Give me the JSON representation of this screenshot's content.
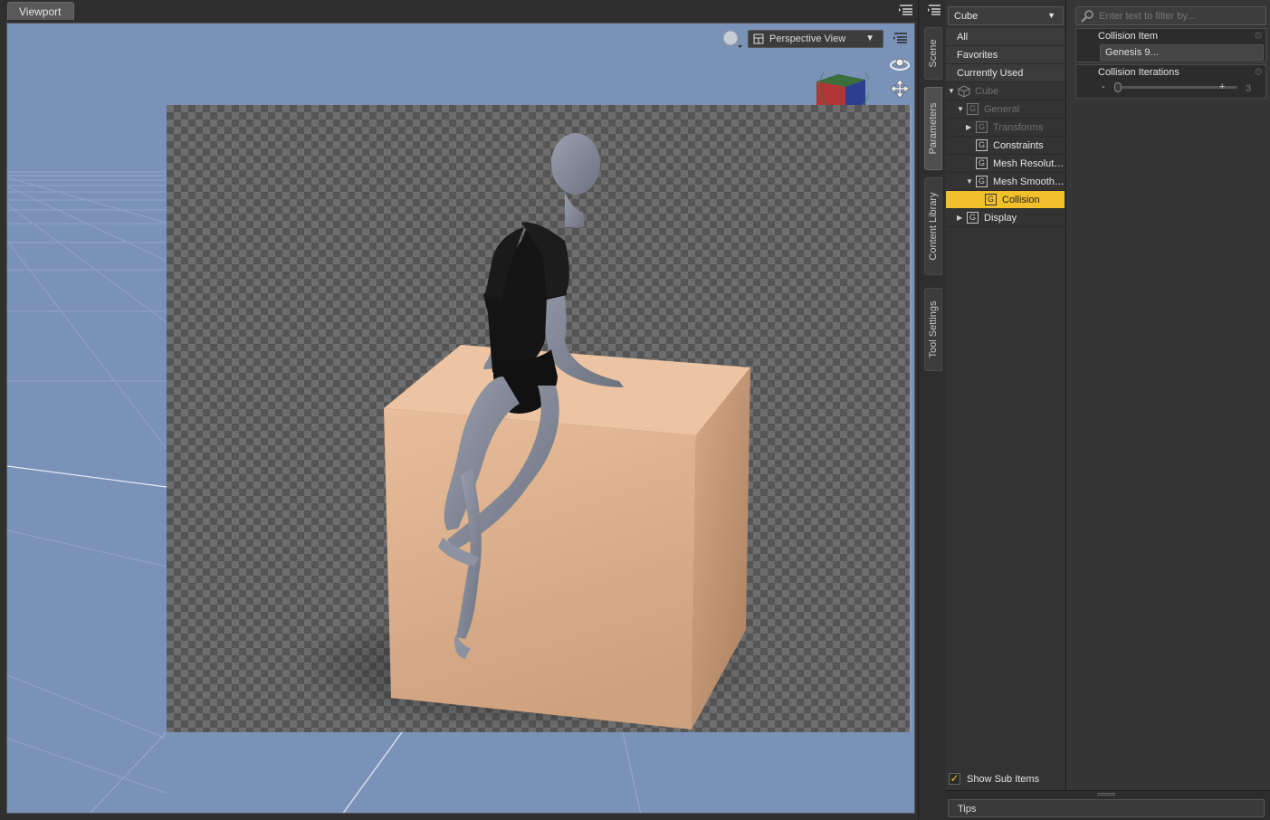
{
  "viewport": {
    "tab_label": "Viewport",
    "view_mode": "Perspective View",
    "icons": [
      "panel-menu-icon",
      "render-preview-icon",
      "camera-icon",
      "orbit-icon",
      "pan-icon",
      "view-cube-icon"
    ]
  },
  "side_tabs": [
    {
      "label": "Scene",
      "active": false
    },
    {
      "label": "Parameters",
      "active": true
    },
    {
      "label": "Content Library",
      "active": false
    },
    {
      "label": "Tool Settings",
      "active": false
    }
  ],
  "params": {
    "node_selector": "Cube",
    "tree": [
      {
        "label": "All"
      },
      {
        "label": "Favorites"
      },
      {
        "label": "Currently Used"
      },
      {
        "label": "Cube"
      },
      {
        "label": "General"
      },
      {
        "label": "Transforms"
      },
      {
        "label": "Constraints"
      },
      {
        "label": "Mesh Resolut…"
      },
      {
        "label": "Mesh Smooth…"
      },
      {
        "label": "Collision"
      },
      {
        "label": "Display"
      }
    ],
    "show_sub_items_label": "Show Sub Items",
    "show_sub_items_checked": true
  },
  "properties": {
    "filter_placeholder": "Enter text to filter by...",
    "collision_item_label": "Collision Item",
    "collision_item_value": "Genesis 9...",
    "collision_iterations_label": "Collision Iterations",
    "collision_iterations_value": "3",
    "collision_iterations_minus": "-",
    "collision_iterations_plus": "+",
    "slider_fraction": 0
  },
  "bottom": {
    "tips_label": "Tips"
  },
  "colors": {
    "accent": "#f2c02a",
    "viewport_bg": "#7b92b8",
    "cube": "#e4b794",
    "figure": "#7d8493"
  }
}
